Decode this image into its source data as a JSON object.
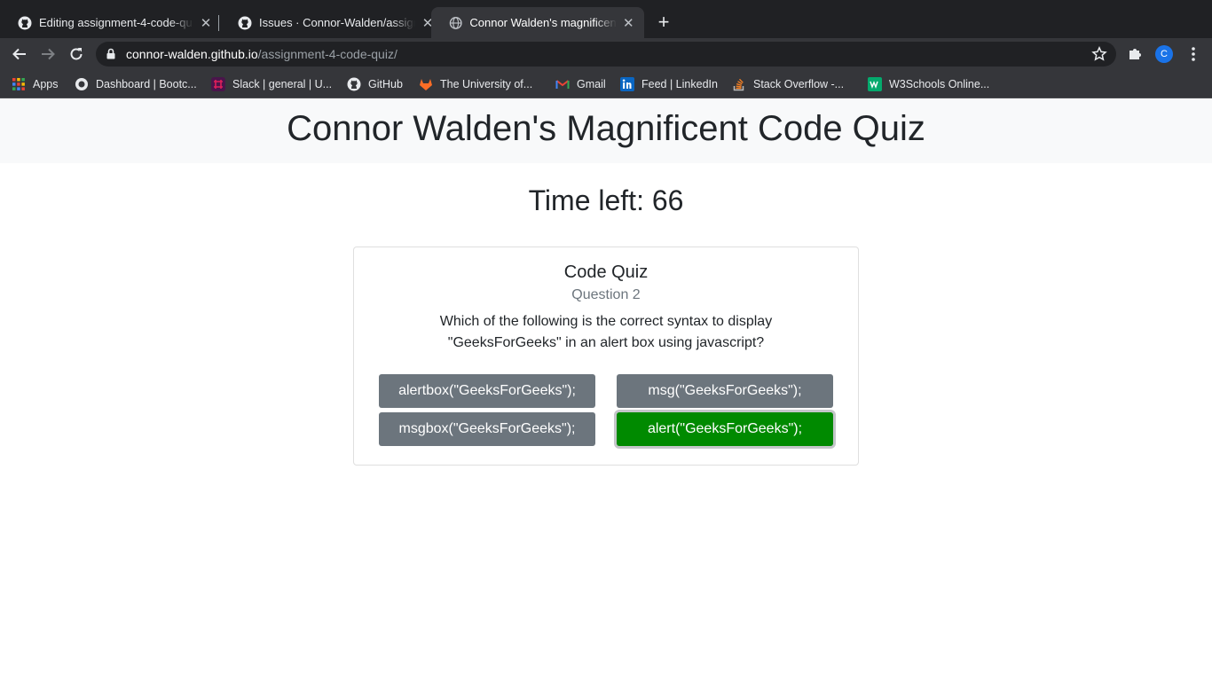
{
  "browser": {
    "tabs": [
      {
        "title": "Editing assignment-4-code-quiz/README.md",
        "icon": "github-icon",
        "active": false
      },
      {
        "title": "Issues · Connor-Walden/assignment-4-code-quiz",
        "icon": "github-icon",
        "active": false
      },
      {
        "title": "Connor Walden's magnificent code quiz",
        "icon": "globe-icon",
        "active": true
      }
    ],
    "close_glyph": "✕",
    "new_tab_glyph": "+",
    "url_host": "connor-walden.github.io",
    "url_path": "/assignment-4-code-quiz/",
    "profile_initial": "C",
    "bookmarks": [
      {
        "label": "Apps",
        "icon": "apps-grid-icon"
      },
      {
        "label": "Dashboard | Bootc...",
        "icon": "bootcamp-icon"
      },
      {
        "label": "Slack | general | U...",
        "icon": "slack-icon"
      },
      {
        "label": "GitHub",
        "icon": "github-icon"
      },
      {
        "label": "The University of...",
        "icon": "gitlab-icon"
      },
      {
        "label": "Gmail",
        "icon": "gmail-icon"
      },
      {
        "label": "Feed | LinkedIn",
        "icon": "linkedin-icon"
      },
      {
        "label": "Stack Overflow -...",
        "icon": "stackoverflow-icon"
      },
      {
        "label": "W3Schools Online...",
        "icon": "w3schools-icon"
      }
    ]
  },
  "page": {
    "title": "Connor Walden's Magnificent Code Quiz",
    "timer_label": "Time left: 66",
    "card": {
      "title": "Code Quiz",
      "subtitle": "Question 2",
      "question": "Which of the following is the correct syntax to display \"GeeksForGeeks\" in an alert box using javascript?",
      "answers": [
        "alertbox(\"GeeksForGeeks\");",
        "msg(\"GeeksForGeeks\");",
        "msgbox(\"GeeksForGeeks\");",
        "alert(\"GeeksForGeeks\");"
      ]
    }
  },
  "colors": {
    "answer_default": "#6c757d",
    "answer_correct": "#008a00",
    "header_bg": "#f8f9fa"
  }
}
